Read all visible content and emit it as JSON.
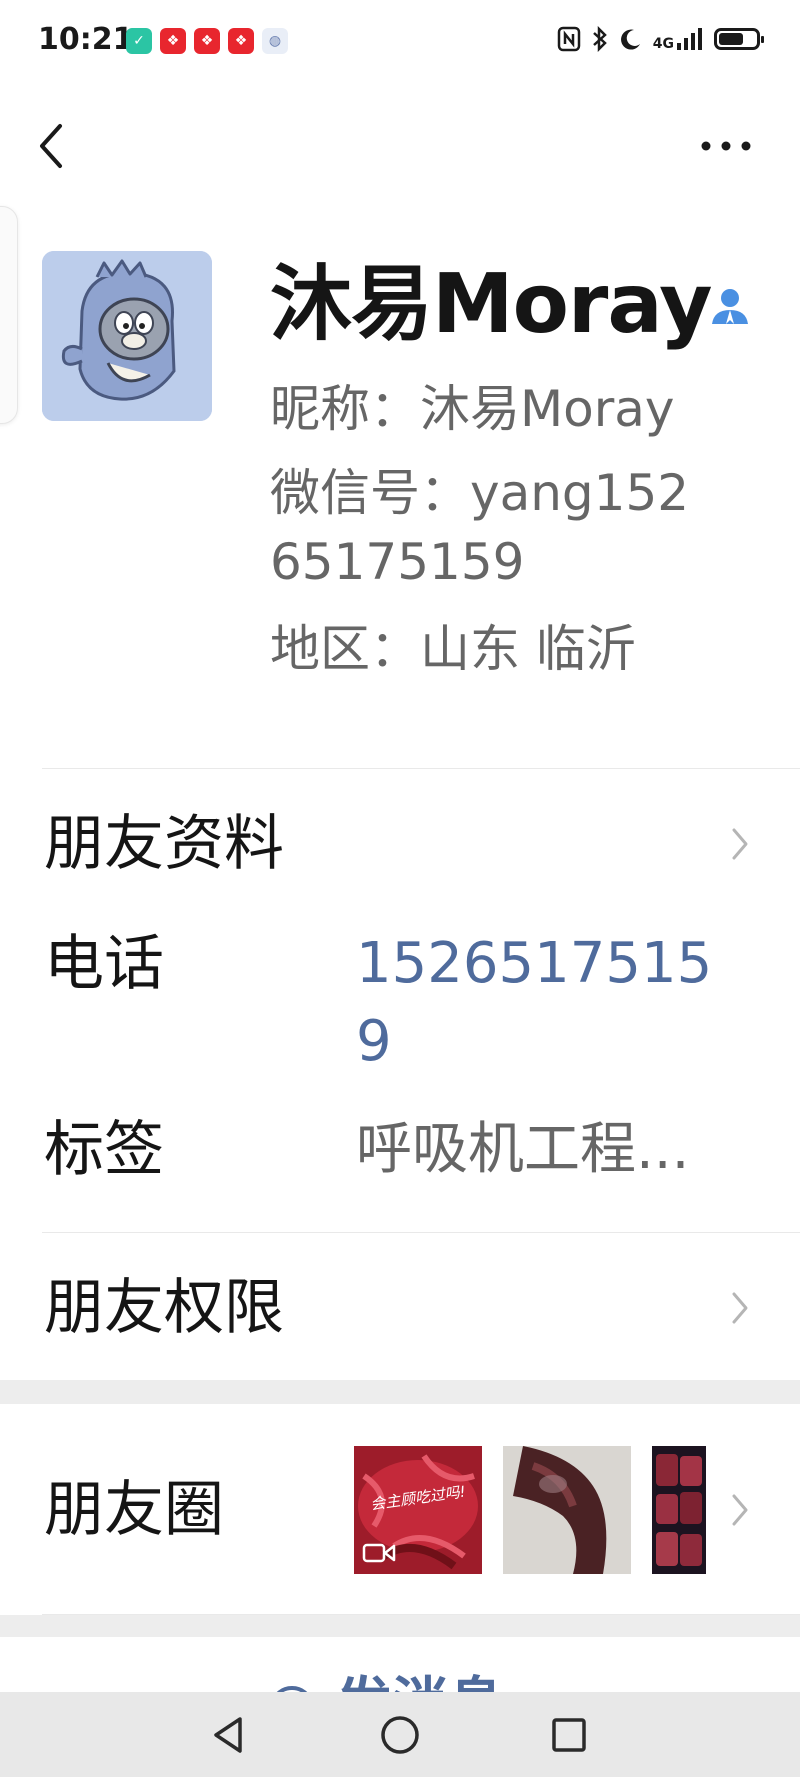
{
  "status_bar": {
    "time": "10:21",
    "network": "4G",
    "battery_percent": 70,
    "left_icons": [
      "shield-icon",
      "app-notification-icon",
      "app-notification-icon",
      "app-notification-icon",
      "globe-icon"
    ],
    "right_icons": [
      "nfc-icon",
      "bluetooth-icon",
      "moon-icon",
      "signal-icon",
      "battery-icon"
    ]
  },
  "profile": {
    "display_name": "沐易Moray",
    "nickname_line": "昵称：沐易Moray",
    "wechat_id_line1": "微信号：yang152",
    "wechat_id_line2": "65175159",
    "region_line": "地区：山东  临沂"
  },
  "rows": {
    "friend_info": {
      "label": "朋友资料"
    },
    "phone": {
      "label": "电话",
      "value_line1": "1526517515",
      "value_line2": "9"
    },
    "tags": {
      "label": "标签",
      "value": "呼吸机工程..."
    },
    "permissions": {
      "label": "朋友权限"
    },
    "moments": {
      "label": "朋友圈",
      "thumb1_caption": "会主顾吃过吗!"
    }
  },
  "partial_action": {
    "label": "发消息"
  },
  "colors": {
    "phone_link": "#4f6b9c",
    "secondary_text": "#666666",
    "contact_badge": "#4a90e2"
  }
}
